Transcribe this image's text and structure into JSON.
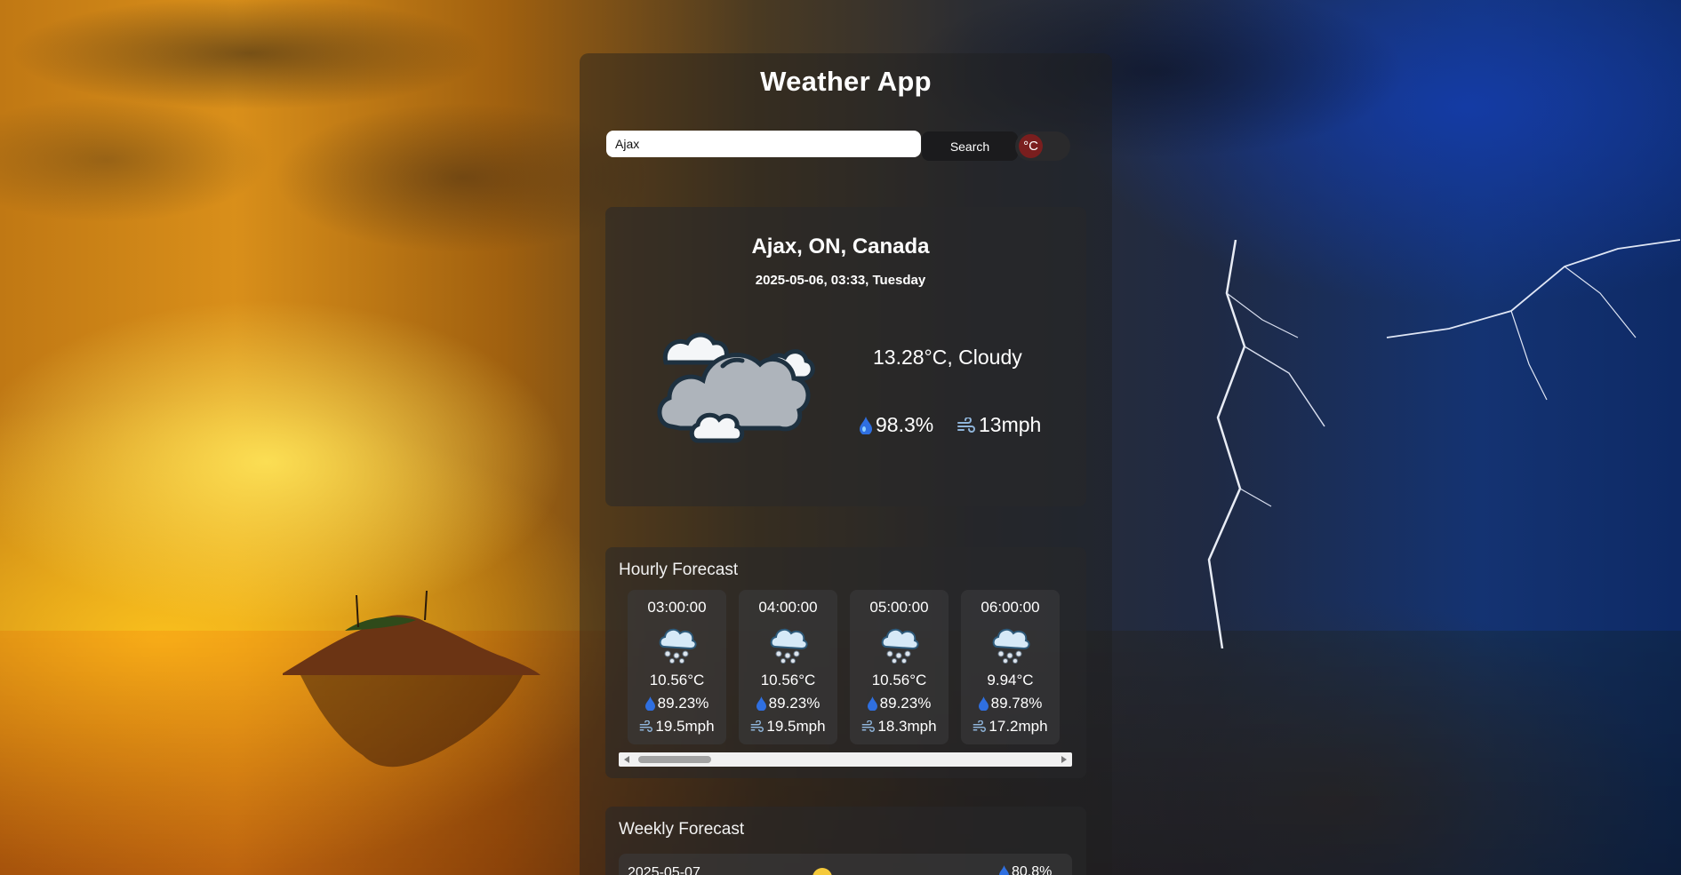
{
  "app": {
    "title": "Weather App"
  },
  "search": {
    "value": "Ajax",
    "button_label": "Search",
    "unit_label": "°C"
  },
  "current": {
    "location": "Ajax, ON, Canada",
    "datetime": "2025-05-06, 03:33, Tuesday",
    "summary": "13.28°C, Cloudy",
    "humidity": "98.3%",
    "wind": "13mph",
    "icon": "cloudy-icon"
  },
  "hourly": {
    "title": "Hourly Forecast",
    "items": [
      {
        "time": "03:00:00",
        "temp": "10.56°C",
        "humidity": "89.23%",
        "wind": "19.5mph",
        "icon": "snow-cloud-icon"
      },
      {
        "time": "04:00:00",
        "temp": "10.56°C",
        "humidity": "89.23%",
        "wind": "19.5mph",
        "icon": "snow-cloud-icon"
      },
      {
        "time": "05:00:00",
        "temp": "10.56°C",
        "humidity": "89.23%",
        "wind": "18.3mph",
        "icon": "snow-cloud-icon"
      },
      {
        "time": "06:00:00",
        "temp": "9.94°C",
        "humidity": "89.78%",
        "wind": "17.2mph",
        "icon": "snow-cloud-icon"
      }
    ]
  },
  "weekly": {
    "title": "Weekly Forecast",
    "items": [
      {
        "date": "2025-05-07",
        "humidity": "80.8%",
        "icon": "sun-icon"
      }
    ]
  },
  "colors": {
    "toggle_knob": "#7a1e1e",
    "drop": "#2f6fe0",
    "card_bg": "rgba(40,40,42,0.55)"
  }
}
